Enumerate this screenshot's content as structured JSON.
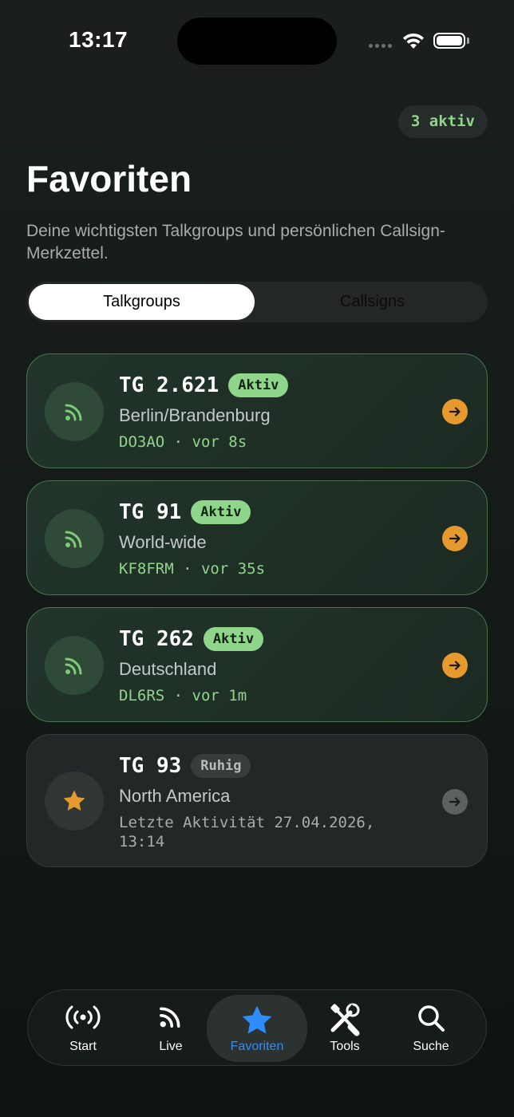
{
  "status_bar": {
    "time": "13:17"
  },
  "header": {
    "active_chip": "3 aktiv",
    "title": "Favoriten",
    "subtitle": "Deine wichtigsten Talkgroups und persönlichen Callsign-Merkzettel."
  },
  "segments": {
    "talkgroups": "Talkgroups",
    "callsigns": "Callsigns",
    "selected": "Talkgroups"
  },
  "cards": [
    {
      "tg": "TG 2.621",
      "status": "Aktiv",
      "region": "Berlin/Brandenburg",
      "meta": "DO3AO · vor 8s",
      "icon": "broadcast-icon"
    },
    {
      "tg": "TG 91",
      "status": "Aktiv",
      "region": "World-wide",
      "meta": "KF8FRM · vor 35s",
      "icon": "broadcast-icon"
    },
    {
      "tg": "TG 262",
      "status": "Aktiv",
      "region": "Deutschland",
      "meta": "DL6RS · vor 1m",
      "icon": "broadcast-icon"
    },
    {
      "tg": "TG 93",
      "status": "Ruhig",
      "region": "North America",
      "meta": "Letzte Aktivität 27.04.2026, 13:14",
      "icon": "star-icon"
    }
  ],
  "tabbar": {
    "start": "Start",
    "live": "Live",
    "favoriten": "Favoriten",
    "tools": "Tools",
    "suche": "Suche"
  },
  "colors": {
    "accent_green": "#8fd68a",
    "accent_orange": "#e69a2e",
    "accent_blue": "#2f8cff"
  }
}
